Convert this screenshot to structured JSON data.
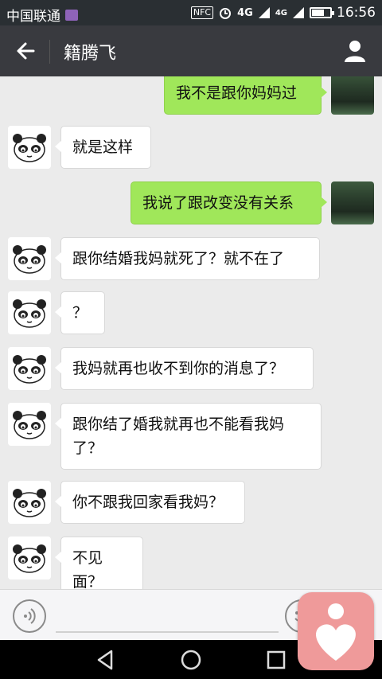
{
  "status_bar": {
    "carrier": "中国联通",
    "nfc": "NFC",
    "network": "4G",
    "network2": "4G",
    "battery_level": 0.7,
    "time": "16:56"
  },
  "header": {
    "title": "籍腾飞"
  },
  "messages": [
    {
      "side": "right",
      "text": "我不是跟你妈妈过"
    },
    {
      "side": "left",
      "text": "就是这样"
    },
    {
      "side": "right",
      "text": "我说了跟改变没有关系"
    },
    {
      "side": "left",
      "text": "跟你结婚我妈就死了？就不在了"
    },
    {
      "side": "left",
      "text": "？"
    },
    {
      "side": "left",
      "text": "我妈就再也收不到你的消息了？"
    },
    {
      "side": "left",
      "text": "跟你结了婚我就再也不能看我妈了？"
    },
    {
      "side": "left",
      "text": "你不跟我回家看我妈？"
    },
    {
      "side": "left",
      "text": "不见面？"
    }
  ],
  "colors": {
    "header_bg": "#393a3f",
    "sent_bubble": "#a0e75a",
    "received_bubble": "#ffffff",
    "chat_bg": "#ebebeb",
    "overlay_app": "#ef9a9a"
  },
  "icons": {
    "back": "back-arrow-icon",
    "profile": "person-icon",
    "voice": "voice-icon",
    "emoji": "emoji-icon",
    "nav_back": "nav-back-icon",
    "nav_home": "nav-home-icon",
    "nav_recent": "nav-recent-icon",
    "overlay": "heart-person-icon"
  }
}
